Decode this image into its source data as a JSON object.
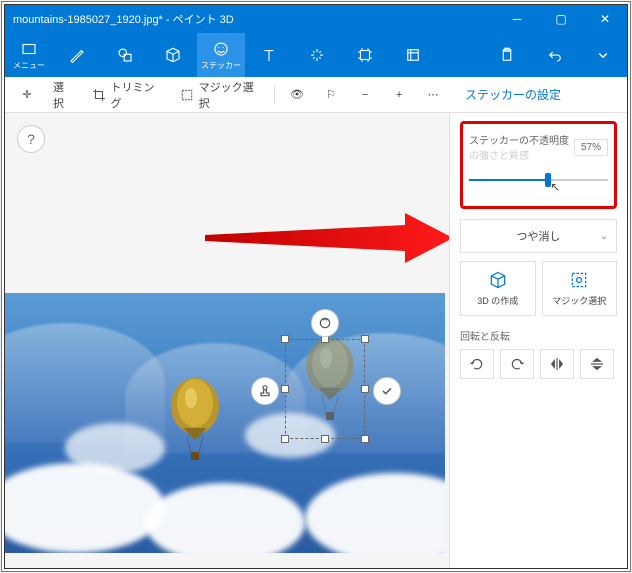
{
  "window": {
    "title": "mountains-1985027_1920.jpg* - ペイント 3D"
  },
  "menu": {
    "label": "メニュー"
  },
  "ribbon": {
    "active_label": "ステッカー"
  },
  "toolbar": {
    "select": "選択",
    "trimming": "トリミング",
    "magic_select": "マジック選択",
    "panel_title": "ステッカーの設定"
  },
  "help": {
    "label": "?"
  },
  "opacity": {
    "label": "ステッカーの不透明度",
    "ghost": "の強さと質感",
    "value": "57%",
    "percent": 57
  },
  "matte": {
    "label": "つや消し"
  },
  "tiles": {
    "make3d": "3D の作成",
    "magic": "マジック選択"
  },
  "rotate": {
    "label": "回転と反転"
  }
}
